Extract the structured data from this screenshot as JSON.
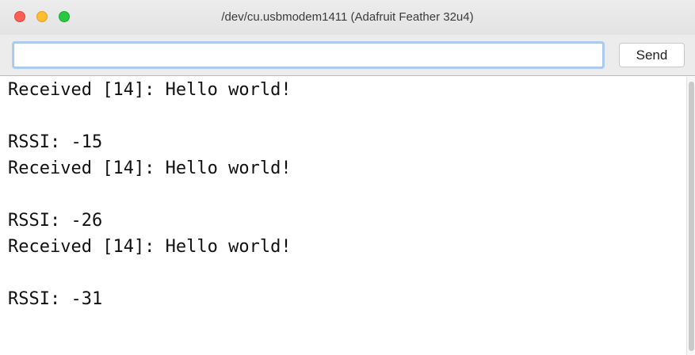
{
  "window": {
    "title": "/dev/cu.usbmodem1411 (Adafruit Feather 32u4)"
  },
  "toolbar": {
    "input_value": "",
    "send_label": "Send"
  },
  "console": {
    "lines": [
      "Received [14]: Hello world!",
      "",
      "RSSI: -15",
      "Received [14]: Hello world!",
      "",
      "RSSI: -26",
      "Received [14]: Hello world!",
      "",
      "RSSI: -31"
    ]
  },
  "colors": {
    "close": "#fd5f57",
    "minimize": "#febc2e",
    "maximize": "#28c840",
    "focus_ring": "#a9cdf5"
  }
}
